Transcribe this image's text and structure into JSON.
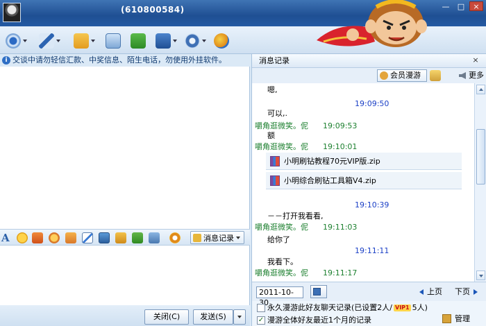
{
  "window": {
    "title": "(610800584)",
    "controls": [
      "—",
      "□",
      "×"
    ]
  },
  "notice": "交谈中请勿轻信汇款、中奖信息、陌生电话，勿使用外挂软件。",
  "format_toolbar": {
    "font_glyph": "A",
    "message_record_label": "消息记录"
  },
  "buttons": {
    "close": "关闭(C)",
    "send": "发送(S)"
  },
  "history": {
    "header": "消息记录",
    "close_glyph": "×",
    "vip_label": "会员漫游",
    "more_label": "更多",
    "messages": [
      {
        "kind": "text",
        "text": "嗯,"
      },
      {
        "kind": "time",
        "time": "19:09:50"
      },
      {
        "kind": "text",
        "text": "可以,."
      },
      {
        "kind": "sender",
        "sender": "嚼角逛微笑。伲",
        "time": "19:09:53"
      },
      {
        "kind": "text",
        "text": "额"
      },
      {
        "kind": "sender",
        "sender": "嚼角逛微笑。伲",
        "time": "19:10:01"
      },
      {
        "kind": "file",
        "text": "小明刷钻教程70元VIP版.zip"
      },
      {
        "kind": "file",
        "text": "小明综合刷钻工具箱V4.zip"
      },
      {
        "kind": "time",
        "time": "19:10:39"
      },
      {
        "kind": "text",
        "text": "－－打开我看看,"
      },
      {
        "kind": "sender",
        "sender": "嚼角逛微笑。伲",
        "time": "19:11:03"
      },
      {
        "kind": "text",
        "text": "给你了"
      },
      {
        "kind": "time",
        "time": "19:11:11"
      },
      {
        "kind": "text",
        "text": "我看下。"
      },
      {
        "kind": "sender",
        "sender": "嚼角逛微笑。伲",
        "time": "19:11:17"
      }
    ],
    "date": "2011-10-30",
    "prev_page": "上页",
    "next_page": "下页",
    "option1_pre": "永久漫游此好友聊天记录(已设置2人/",
    "option1_badge": "VIP1",
    "option1_post": "5人)",
    "option1_checked": false,
    "option2": "漫游全体好友最近1个月的记录",
    "option2_checked": true,
    "manage": "管理"
  },
  "colors": {
    "sender_green": "#1b7f2e",
    "time_blue": "#1a3fc6",
    "title_bar": "#2a5ea6"
  }
}
